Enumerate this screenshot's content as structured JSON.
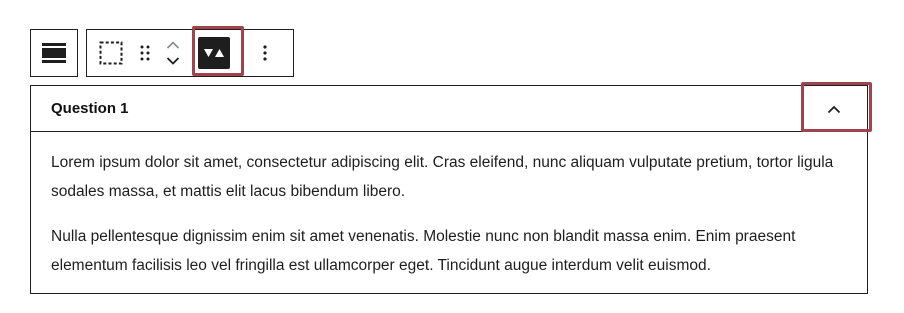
{
  "toolbar": {
    "parent_button": {
      "icon": "block-parent-icon"
    },
    "select_button": {
      "icon": "dashed-square-icon"
    },
    "drag_handle": {
      "icon": "drag-handle-icon"
    },
    "mover": {
      "up_icon": "chevron-up-icon",
      "down_icon": "chevron-down-icon"
    },
    "toggle_button": {
      "icon": "accordion-toggle-icon",
      "active": true
    },
    "more_button": {
      "icon": "more-vertical-icon"
    }
  },
  "accordion": {
    "title": "Question 1",
    "toggle_icon": "chevron-up-icon",
    "expanded": true,
    "paragraphs": [
      "Lorem ipsum dolor sit amet, consectetur adipiscing elit. Cras eleifend, nunc aliquam vulputate pretium, tortor ligula sodales massa, et mattis elit lacus bibendum libero.",
      "Nulla pellentesque dignissim enim sit amet venenatis. Molestie nunc non blandit massa enim. Enim praesent elementum facilisis leo vel fringilla est ullamcorper eget. Tincidunt augue interdum velit euismod."
    ]
  },
  "colors": {
    "highlight": "#a0434c",
    "ink": "#1e1e1e",
    "background": "#ffffff"
  }
}
